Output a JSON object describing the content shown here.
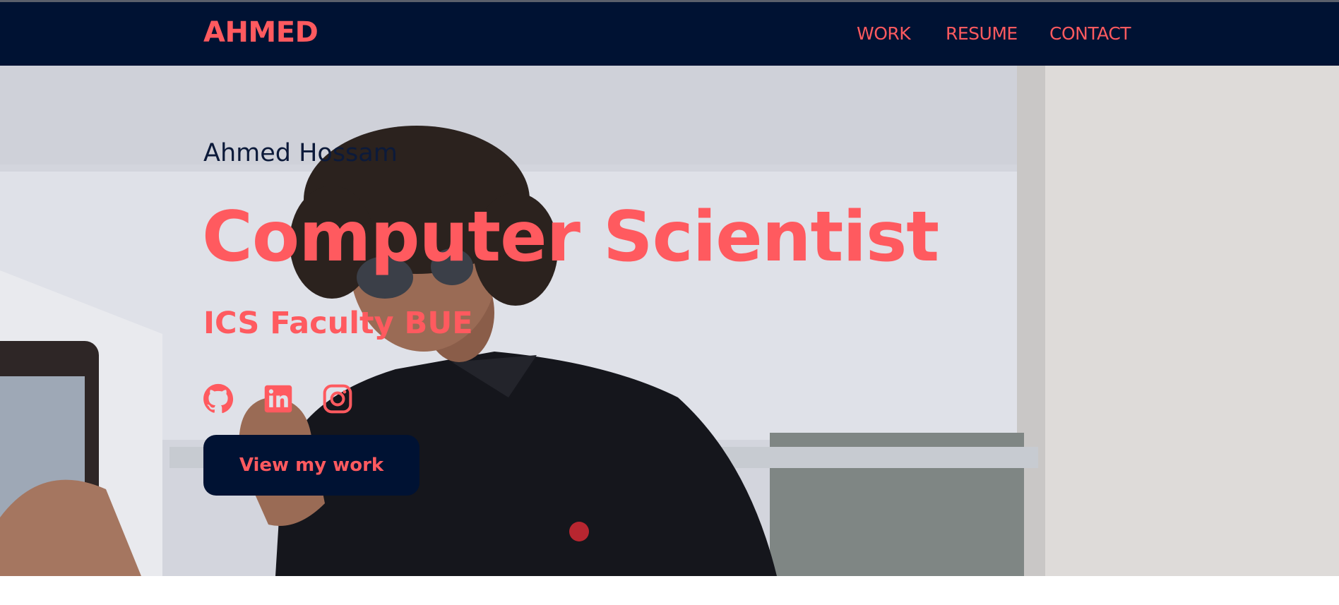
{
  "brand": {
    "name": "AHMED"
  },
  "nav": {
    "items": [
      {
        "label": "WORK"
      },
      {
        "label": "RESUME"
      },
      {
        "label": "CONTACT"
      }
    ]
  },
  "hero": {
    "name": "Ahmed Hossam",
    "title": "Computer Scientist",
    "subtitle": "ICS Faculty BUE",
    "socials": [
      {
        "icon": "github-icon"
      },
      {
        "icon": "linkedin-icon"
      },
      {
        "icon": "instagram-icon"
      }
    ],
    "cta_label": "View my work"
  },
  "colors": {
    "accent": "#ff5a5f",
    "navy": "#001233",
    "name_text": "#0c1a3a"
  }
}
